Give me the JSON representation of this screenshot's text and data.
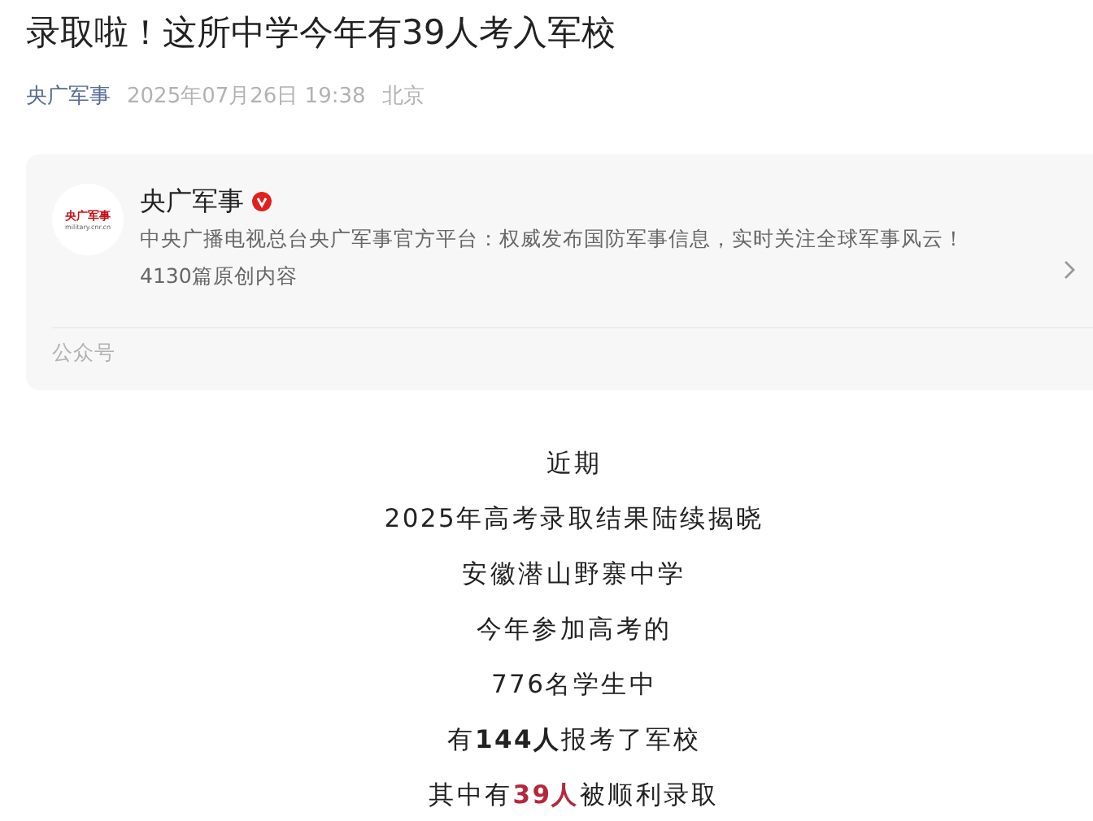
{
  "article": {
    "title": "录取啦！这所中学今年有39人考入军校",
    "author": "央广军事",
    "date": "2025年07月26日 19:38",
    "location": "北京"
  },
  "account_card": {
    "avatar_text": "央广军事",
    "avatar_subtext": "military.cnr.cn",
    "name": "央广军事",
    "verified": true,
    "description": "中央广播电视总台央广军事官方平台：权威发布国防军事信息，实时关注全球军事风云！",
    "count": "4130篇原创内容",
    "type_label": "公众号"
  },
  "body_lines": [
    [
      {
        "kind": "plain",
        "text": "近期"
      }
    ],
    [
      {
        "kind": "plain",
        "text": "2025年高考录取结果陆续揭晓"
      }
    ],
    [
      {
        "kind": "plain",
        "text": "安徽潜山野寨中学"
      }
    ],
    [
      {
        "kind": "plain",
        "text": "今年参加高考的"
      }
    ],
    [
      {
        "kind": "plain",
        "text": "776名学生中"
      }
    ],
    [
      {
        "kind": "plain",
        "text": "有"
      },
      {
        "kind": "bold",
        "text": "144人"
      },
      {
        "kind": "plain",
        "text": "报考了军校"
      }
    ],
    [
      {
        "kind": "plain",
        "text": "其中有"
      },
      {
        "kind": "accent",
        "text": "39人"
      },
      {
        "kind": "plain",
        "text": "被顺利录取"
      }
    ]
  ]
}
